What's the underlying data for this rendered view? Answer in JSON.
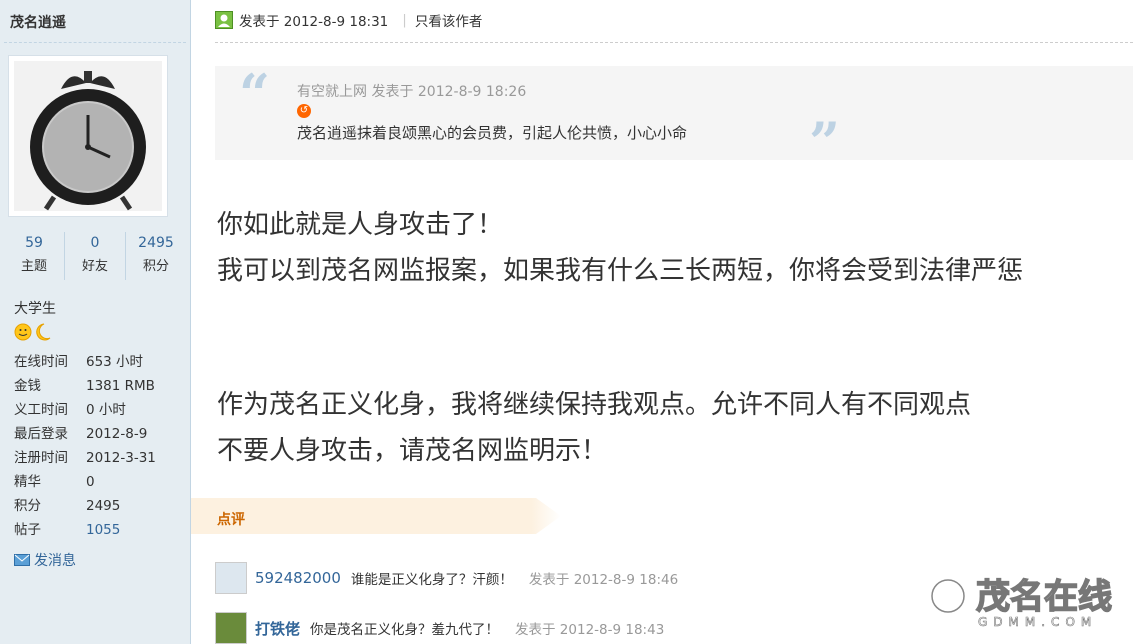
{
  "sidebar": {
    "author_name": "茂名逍遥",
    "stats": [
      {
        "num": "59",
        "label": "主题"
      },
      {
        "num": "0",
        "label": "好友"
      },
      {
        "num": "2495",
        "label": "积分"
      }
    ],
    "rank": "大学生",
    "info": [
      {
        "label": "在线时间",
        "value": "653 小时"
      },
      {
        "label": "金钱",
        "value": "1381 RMB"
      },
      {
        "label": "义工时间",
        "value": "0 小时"
      },
      {
        "label": "最后登录",
        "value": "2012-8-9"
      },
      {
        "label": "注册时间",
        "value": "2012-3-31"
      },
      {
        "label": "精华",
        "value": "0"
      },
      {
        "label": "积分",
        "value": "2495"
      },
      {
        "label": "帖子",
        "value": "1055"
      }
    ],
    "send_message": "发消息"
  },
  "post": {
    "posted_at": "发表于 2012-8-9 18:31",
    "only_author": "只看该作者",
    "quote": {
      "meta": "有空就上网 发表于 2012-8-9 18:26",
      "text": "茂名逍遥抹着良颂黑心的会员费，引起人伦共愤，小心小命"
    },
    "lines": [
      "你如此就是人身攻击了！",
      "我可以到茂名网监报案，如果我有什么三长两短，你将会受到法律严惩",
      "作为茂名正义化身，我将继续保持我观点。允许不同人有不同观点",
      "不要人身攻击，请茂名网监明示！"
    ]
  },
  "rating": {
    "label": "点评",
    "comments": [
      {
        "user": "592482000",
        "text": "谁能是正义化身了？汗颜！",
        "time": "发表于 2012-8-9 18:46"
      },
      {
        "user": "打铁佬",
        "text": "你是茂名正义化身？羞九代了！",
        "time": "发表于 2012-8-9 18:43"
      }
    ]
  },
  "watermark": {
    "title": "茂名在线",
    "subtitle": "GDMM.COM"
  }
}
